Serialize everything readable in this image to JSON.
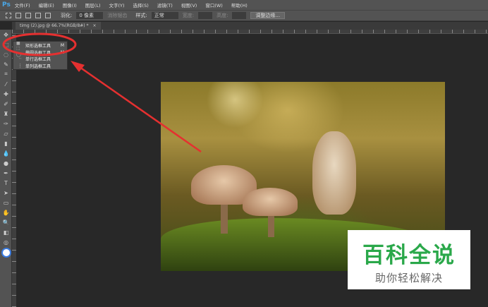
{
  "app": {
    "logo": "Ps"
  },
  "menu": [
    "文件(F)",
    "编辑(E)",
    "图像(I)",
    "图层(L)",
    "文字(Y)",
    "选择(S)",
    "滤镜(T)",
    "视图(V)",
    "窗口(W)",
    "帮助(H)"
  ],
  "options": {
    "feather_label": "羽化:",
    "feather_value": "0 像素",
    "antialias": "消除锯齿",
    "style_label": "样式:",
    "style_value": "正常",
    "width_label": "宽度:",
    "height_label": "高度:",
    "refine_edge": "调整边缘..."
  },
  "document_tab": {
    "title": "timg (2).jpg @ 66.7%(RGB/8#) *",
    "close": "×"
  },
  "flyout": [
    {
      "label": "矩形选框工具",
      "shortcut": "M",
      "active": true
    },
    {
      "label": "椭圆选框工具",
      "shortcut": "M"
    },
    {
      "label": "单行选框工具",
      "shortcut": ""
    },
    {
      "label": "单列选框工具",
      "shortcut": ""
    }
  ],
  "watermark": {
    "title": "百科全说",
    "subtitle": "助你轻松解决"
  },
  "colors": {
    "annotation": "#e53030",
    "brand_green": "#2aa84a"
  }
}
